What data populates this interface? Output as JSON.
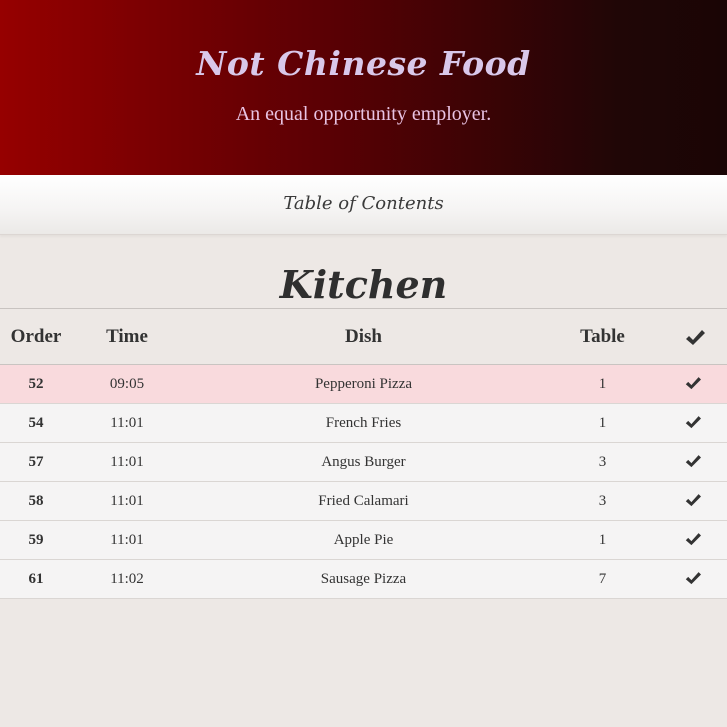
{
  "header": {
    "brand": "Not Chinese Food",
    "tagline": "An equal opportunity employer."
  },
  "nav": {
    "toc_label": "Table of Contents"
  },
  "page": {
    "title": "Kitchen"
  },
  "table": {
    "columns": [
      "Order",
      "Time",
      "Dish",
      "Table"
    ],
    "done_column_icon": "check-icon",
    "rows": [
      {
        "order": "52",
        "time": "09:05",
        "dish": "Pepperoni Pizza",
        "table": "1",
        "highlighted": true
      },
      {
        "order": "54",
        "time": "11:01",
        "dish": "French Fries",
        "table": "1",
        "highlighted": false
      },
      {
        "order": "57",
        "time": "11:01",
        "dish": "Angus Burger",
        "table": "3",
        "highlighted": false
      },
      {
        "order": "58",
        "time": "11:01",
        "dish": "Fried Calamari",
        "table": "3",
        "highlighted": false
      },
      {
        "order": "59",
        "time": "11:01",
        "dish": "Apple Pie",
        "table": "1",
        "highlighted": false
      },
      {
        "order": "61",
        "time": "11:02",
        "dish": "Sausage Pizza",
        "table": "7",
        "highlighted": false
      }
    ]
  },
  "colors": {
    "header_red": "#960000",
    "header_dark": "#1a0505",
    "brand_text": "#d9c8ea",
    "highlight_row": "#f9dadd",
    "page_bg": "#ede8e5"
  }
}
